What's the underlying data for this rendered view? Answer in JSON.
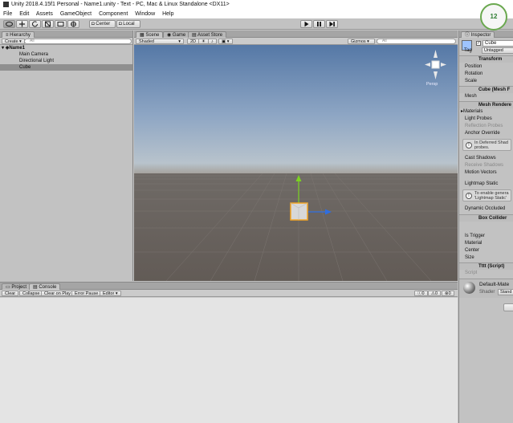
{
  "window": {
    "title": "Unity 2018.4.15f1 Personal - Name1.unity - Text - PC, Mac & Linux Standalone <DX11>"
  },
  "menu": [
    "File",
    "Edit",
    "Assets",
    "GameObject",
    "Component",
    "Window",
    "Help"
  ],
  "toolbar": {
    "pivot_label": "Center",
    "space_label": "Local",
    "fps": "12"
  },
  "hierarchy": {
    "tab": "Hierarchy",
    "create": "Create",
    "search_placeholder": "All",
    "scene": "Name1",
    "items": [
      "Main Camera",
      "Directional Light",
      "Cube"
    ]
  },
  "scene_view": {
    "tabs": [
      "Scene",
      "Game",
      "Asset Store"
    ],
    "shading": "Shaded",
    "mode_2d": "2D",
    "gizmos": "Gizmos",
    "search_placeholder": "All",
    "persp": "Persp"
  },
  "inspector": {
    "tab": "Inspector",
    "object_name": "Cube",
    "tag_label": "Tag",
    "tag_value": "Untagged",
    "transform": {
      "title": "Transform",
      "rows": [
        "Position",
        "Rotation",
        "Scale"
      ]
    },
    "mesh_filter": {
      "title": "Cube (Mesh F",
      "rows": [
        "Mesh"
      ]
    },
    "mesh_renderer": {
      "title": "Mesh Rendere",
      "materials": "Materials",
      "light_probes": "Light Probes",
      "reflection_probes": "Reflection Probes",
      "anchor_override": "Anchor Override",
      "help1_line1": "In Deferred Shad",
      "help1_line2": "probes.",
      "cast_shadows": "Cast Shadows",
      "receive_shadows": "Receive Shadows",
      "motion_vectors": "Motion Vectors",
      "lightmap_static": "Lightmap Static",
      "help2_line1": "To enable genera",
      "help2_line2": "'Lightmap Static'",
      "dynamic_occluded": "Dynamic Occluded"
    },
    "box_collider": {
      "title": "Box Collider",
      "rows": [
        "Is Trigger",
        "Material",
        "Center",
        "Size"
      ]
    },
    "script": {
      "title": "Tttt (Script)",
      "rows": [
        "Script"
      ]
    },
    "material": {
      "name": "Default-Mate",
      "shader_label": "Shader",
      "shader_value": "Stand"
    }
  },
  "console": {
    "tabs": [
      "Project",
      "Console"
    ],
    "buttons": [
      "Clear",
      "Collapse",
      "Clear on Play",
      "Error Pause",
      "Editor"
    ],
    "counts": [
      "0",
      "0",
      "0"
    ]
  }
}
